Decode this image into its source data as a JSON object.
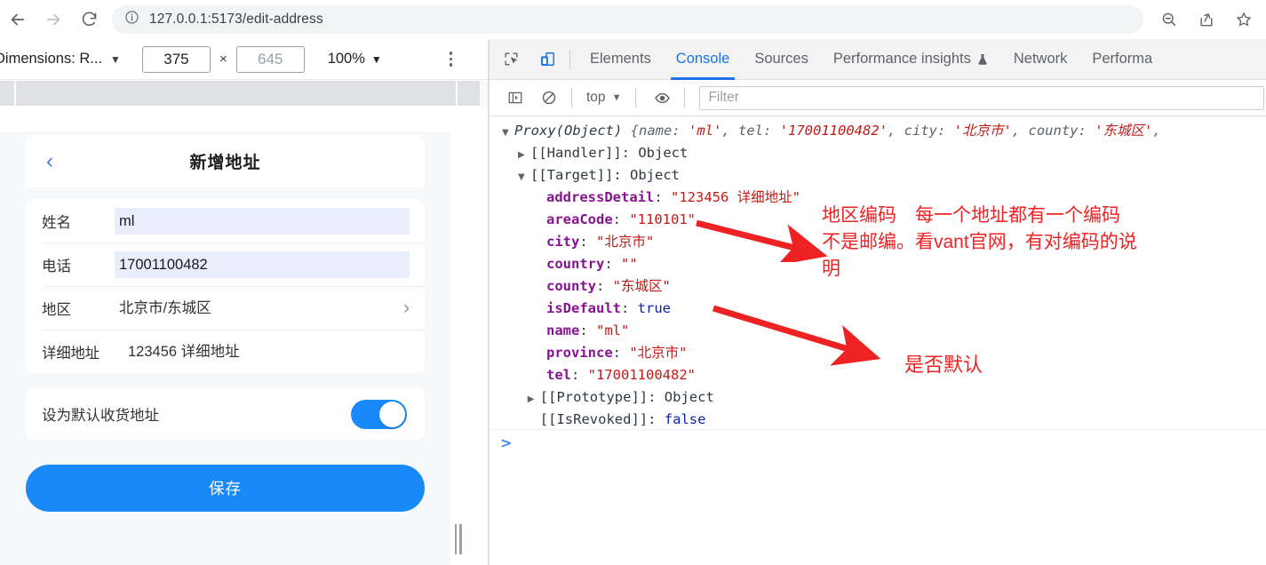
{
  "browser": {
    "url": "127.0.0.1:5173/edit-address",
    "back_label": "Back",
    "forward_label": "Forward",
    "reload_label": "Reload",
    "info_icon": "info-circle-icon",
    "zoom_out_icon": "zoom-out-icon",
    "share_icon": "share-icon",
    "bookmark_icon": "star-icon"
  },
  "device_toolbar": {
    "dimensions_label": "Dimensions: R...",
    "caret": "▼",
    "width_value": "375",
    "height_placeholder": "645",
    "times": "×",
    "zoom_label": "100%",
    "more_label": "More options"
  },
  "app": {
    "back_chevron": "‹",
    "title": "新增地址",
    "fields": [
      {
        "label": "姓名",
        "value": "ml",
        "type": "autofill"
      },
      {
        "label": "电话",
        "value": "17001100482",
        "type": "autofill"
      },
      {
        "label": "地区",
        "value": "北京市/东城区",
        "type": "picker"
      },
      {
        "label": "详细地址",
        "value": "123456 详细地址",
        "type": "text"
      }
    ],
    "chevron": "›",
    "switch_label": "设为默认收货地址",
    "switch_on": true,
    "save_label": "保存",
    "accent_color": "#1989fa",
    "autofill_color": "#e8eefc"
  },
  "devtools": {
    "inspect_icon": "inspect-element-icon",
    "device_toggle_icon": "device-toolbar-icon",
    "tabs": [
      {
        "label": "Elements",
        "active": false
      },
      {
        "label": "Console",
        "active": true
      },
      {
        "label": "Sources",
        "active": false
      },
      {
        "label": "Performance insights",
        "active": false,
        "icon": "flask-icon"
      },
      {
        "label": "Network",
        "active": false
      },
      {
        "label": "Performa",
        "active": false
      }
    ],
    "toolbar": {
      "sidebar_icon": "console-sidebar-icon",
      "clear_icon": "clear-console-icon",
      "context_label": "top",
      "context_caret": "▼",
      "eye_icon": "live-expression-icon",
      "filter_placeholder": "Filter"
    },
    "console": {
      "prompt": ">",
      "lines": [
        {
          "indent": 0,
          "twisty": "▼",
          "segments": [
            {
              "t": "Proxy(Object) ",
              "c": "obj-name ital"
            },
            {
              "t": "{",
              "c": "v-grey ital"
            },
            {
              "t": "name",
              "c": "v-grey ital"
            },
            {
              "t": ": ",
              "c": "v-grey ital"
            },
            {
              "t": "'ml'",
              "c": "v-str ital"
            },
            {
              "t": ", ",
              "c": "v-grey ital"
            },
            {
              "t": "tel",
              "c": "v-grey ital"
            },
            {
              "t": ": ",
              "c": "v-grey ital"
            },
            {
              "t": "'17001100482'",
              "c": "v-str ital"
            },
            {
              "t": ", ",
              "c": "v-grey ital"
            },
            {
              "t": "city",
              "c": "v-grey ital"
            },
            {
              "t": ": ",
              "c": "v-grey ital"
            },
            {
              "t": "'北京市'",
              "c": "v-str ital"
            },
            {
              "t": ", ",
              "c": "v-grey ital"
            },
            {
              "t": "county",
              "c": "v-grey ital"
            },
            {
              "t": ": ",
              "c": "v-grey ital"
            },
            {
              "t": "'东城区'",
              "c": "v-str ital"
            },
            {
              "t": ",",
              "c": "v-grey ital"
            }
          ]
        },
        {
          "indent": 1,
          "twisty": "▶",
          "segments": [
            {
              "t": "[[Handler]]",
              "c": "k-plain"
            },
            {
              "t": ": ",
              "c": "k-plain"
            },
            {
              "t": "Object",
              "c": "k-plain"
            }
          ]
        },
        {
          "indent": 1,
          "twisty": "▼",
          "segments": [
            {
              "t": "[[Target]]",
              "c": "k-plain"
            },
            {
              "t": ": ",
              "c": "k-plain"
            },
            {
              "t": "Object",
              "c": "k-plain"
            }
          ]
        },
        {
          "indent": 2,
          "twisty": "",
          "segments": [
            {
              "t": "addressDetail",
              "c": "k-name"
            },
            {
              "t": ": ",
              "c": "k-plain"
            },
            {
              "t": "\"123456 详细地址\"",
              "c": "v-str"
            }
          ]
        },
        {
          "indent": 2,
          "twisty": "",
          "segments": [
            {
              "t": "areaCode",
              "c": "k-name"
            },
            {
              "t": ": ",
              "c": "k-plain"
            },
            {
              "t": "\"110101\"",
              "c": "v-str"
            }
          ]
        },
        {
          "indent": 2,
          "twisty": "",
          "segments": [
            {
              "t": "city",
              "c": "k-name"
            },
            {
              "t": ": ",
              "c": "k-plain"
            },
            {
              "t": "\"北京市\"",
              "c": "v-str"
            }
          ]
        },
        {
          "indent": 2,
          "twisty": "",
          "segments": [
            {
              "t": "country",
              "c": "k-name"
            },
            {
              "t": ": ",
              "c": "k-plain"
            },
            {
              "t": "\"\"",
              "c": "v-str"
            }
          ]
        },
        {
          "indent": 2,
          "twisty": "",
          "segments": [
            {
              "t": "county",
              "c": "k-name"
            },
            {
              "t": ": ",
              "c": "k-plain"
            },
            {
              "t": "\"东城区\"",
              "c": "v-str"
            }
          ]
        },
        {
          "indent": 2,
          "twisty": "",
          "segments": [
            {
              "t": "isDefault",
              "c": "k-name"
            },
            {
              "t": ": ",
              "c": "k-plain"
            },
            {
              "t": "true",
              "c": "v-bool"
            }
          ]
        },
        {
          "indent": 2,
          "twisty": "",
          "segments": [
            {
              "t": "name",
              "c": "k-name"
            },
            {
              "t": ": ",
              "c": "k-plain"
            },
            {
              "t": "\"ml\"",
              "c": "v-str"
            }
          ]
        },
        {
          "indent": 2,
          "twisty": "",
          "segments": [
            {
              "t": "province",
              "c": "k-name"
            },
            {
              "t": ": ",
              "c": "k-plain"
            },
            {
              "t": "\"北京市\"",
              "c": "v-str"
            }
          ]
        },
        {
          "indent": 2,
          "twisty": "",
          "segments": [
            {
              "t": "tel",
              "c": "k-name"
            },
            {
              "t": ": ",
              "c": "k-plain"
            },
            {
              "t": "\"17001100482\"",
              "c": "v-str"
            }
          ]
        },
        {
          "indent": 1.6,
          "twisty": "▶",
          "segments": [
            {
              "t": "[[Prototype]]",
              "c": "k-plain"
            },
            {
              "t": ": ",
              "c": "k-plain"
            },
            {
              "t": "Object",
              "c": "k-plain"
            }
          ]
        },
        {
          "indent": 1.6,
          "twisty": "",
          "segments": [
            {
              "t": "[[IsRevoked]]",
              "c": "k-plain"
            },
            {
              "t": ": ",
              "c": "k-plain"
            },
            {
              "t": "false",
              "c": "v-bool"
            }
          ]
        }
      ]
    }
  },
  "annotations": {
    "color": "#ee2222",
    "note_area_code": "地区编码　每一个地址都有一个编码\n不是邮编。看vant官网，有对编码的说\n明",
    "note_is_default": "是否默认"
  }
}
